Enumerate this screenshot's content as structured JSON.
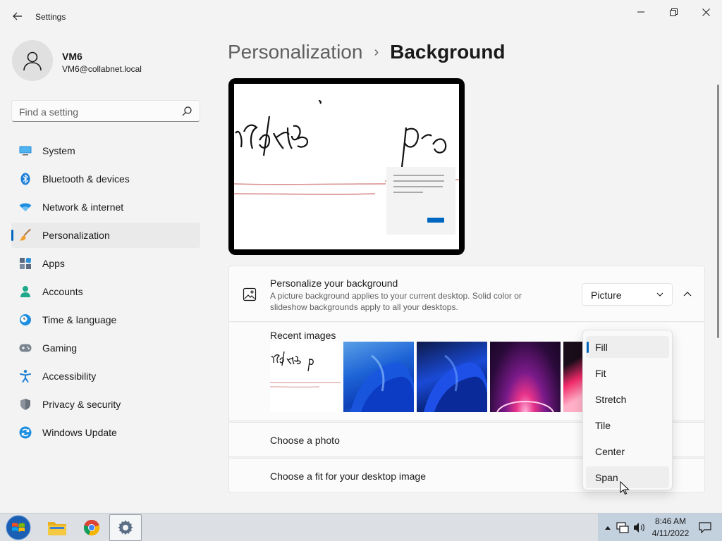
{
  "window": {
    "title": "Settings"
  },
  "user": {
    "name": "VM6",
    "email": "VM6@collabnet.local"
  },
  "search": {
    "placeholder": "Find a setting"
  },
  "nav": [
    {
      "label": "System",
      "icon": "monitor-icon"
    },
    {
      "label": "Bluetooth & devices",
      "icon": "bluetooth-icon"
    },
    {
      "label": "Network & internet",
      "icon": "wifi-icon"
    },
    {
      "label": "Personalization",
      "icon": "brush-icon",
      "active": true
    },
    {
      "label": "Apps",
      "icon": "apps-icon"
    },
    {
      "label": "Accounts",
      "icon": "person-icon"
    },
    {
      "label": "Time & language",
      "icon": "clock-globe-icon"
    },
    {
      "label": "Gaming",
      "icon": "gamepad-icon"
    },
    {
      "label": "Accessibility",
      "icon": "accessibility-icon"
    },
    {
      "label": "Privacy & security",
      "icon": "shield-icon"
    },
    {
      "label": "Windows Update",
      "icon": "update-icon"
    }
  ],
  "header": {
    "parent": "Personalization",
    "separator": "›",
    "current": "Background"
  },
  "background": {
    "title": "Personalize your background",
    "description": "A picture background applies to your current desktop. Solid color or slideshow backgrounds apply to all your desktops.",
    "type_value": "Picture",
    "recent_label": "Recent images",
    "choose_photo_label": "Choose a photo",
    "fit_label": "Choose a fit for your desktop image"
  },
  "fit_menu": {
    "options": [
      "Fill",
      "Fit",
      "Stretch",
      "Tile",
      "Center",
      "Span"
    ],
    "selected": "Fill",
    "hovered": "Span"
  },
  "taskbar": {
    "time": "8:46 AM",
    "date": "4/11/2022"
  },
  "colors": {
    "accent": "#0067c0",
    "window_bg": "#f3f3f3",
    "card_bg": "#fbfbfb"
  }
}
